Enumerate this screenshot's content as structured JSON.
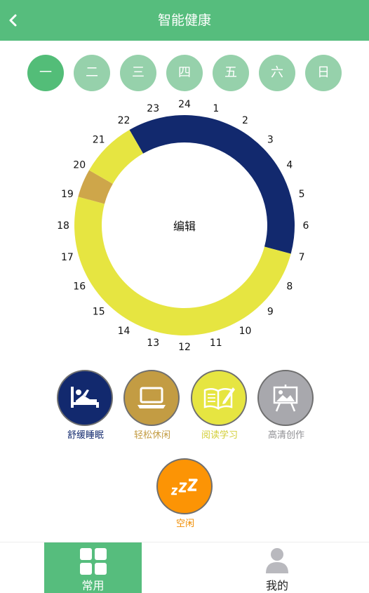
{
  "header": {
    "title": "智能健康"
  },
  "days": [
    "一",
    "二",
    "三",
    "四",
    "五",
    "六",
    "日"
  ],
  "active_day": 0,
  "clock": {
    "hour_labels": [
      "1",
      "2",
      "3",
      "4",
      "5",
      "6",
      "7",
      "8",
      "9",
      "10",
      "11",
      "12",
      "13",
      "14",
      "15",
      "16",
      "17",
      "18",
      "19",
      "20",
      "21",
      "22",
      "23",
      "24"
    ],
    "center_label": "编辑",
    "segments": [
      {
        "from_hour": 22,
        "to_hour": 31,
        "mode": "sleep",
        "color": "#12296e"
      },
      {
        "from_hour": 7,
        "to_hour": 19,
        "mode": "reading",
        "color": "#e6e541"
      },
      {
        "from_hour": 19,
        "to_hour": 20,
        "mode": "leisure",
        "color": "#cea64a"
      },
      {
        "from_hour": 20,
        "to_hour": 22,
        "mode": "reading",
        "color": "#e6e541"
      }
    ]
  },
  "modes": [
    {
      "label": "舒缓睡眠",
      "color": "#12296e",
      "text_color": "#12296e",
      "icon": "sleep-bed-icon"
    },
    {
      "label": "轻松休闲",
      "color": "#c39c43",
      "text_color": "#c39c43",
      "icon": "laptop-icon"
    },
    {
      "label": "阅读学习",
      "color": "#e6e541",
      "text_color": "#d3cf37",
      "icon": "book-pen-icon"
    },
    {
      "label": "高清创作",
      "color": "#a8a8ad",
      "text_color": "#8e8e92",
      "icon": "easel-picture-icon"
    },
    {
      "label": "空闲",
      "color": "#fc9405",
      "text_color": "#f08c00",
      "icon": "zzz-icon"
    }
  ],
  "tabbar": {
    "tabs": [
      {
        "label": "常用",
        "icon": "grid-icon",
        "active": true
      },
      {
        "label": "我的",
        "icon": "person-icon",
        "active": false
      }
    ]
  }
}
